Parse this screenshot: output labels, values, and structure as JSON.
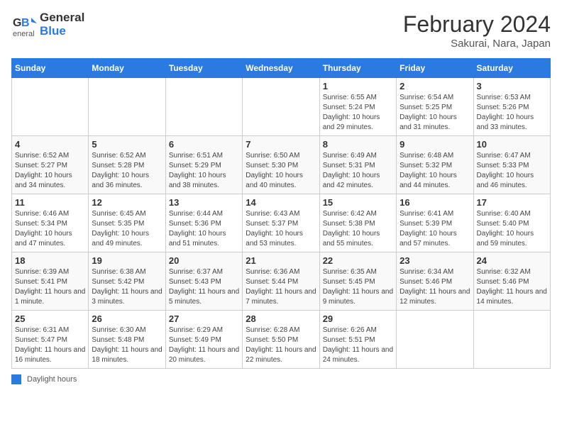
{
  "header": {
    "logo_line1": "General",
    "logo_line2": "Blue",
    "month": "February 2024",
    "location": "Sakurai, Nara, Japan"
  },
  "weekdays": [
    "Sunday",
    "Monday",
    "Tuesday",
    "Wednesday",
    "Thursday",
    "Friday",
    "Saturday"
  ],
  "weeks": [
    [
      {
        "day": "",
        "sunrise": "",
        "sunset": "",
        "daylight": ""
      },
      {
        "day": "",
        "sunrise": "",
        "sunset": "",
        "daylight": ""
      },
      {
        "day": "",
        "sunrise": "",
        "sunset": "",
        "daylight": ""
      },
      {
        "day": "",
        "sunrise": "",
        "sunset": "",
        "daylight": ""
      },
      {
        "day": "1",
        "sunrise": "Sunrise: 6:55 AM",
        "sunset": "Sunset: 5:24 PM",
        "daylight": "Daylight: 10 hours and 29 minutes."
      },
      {
        "day": "2",
        "sunrise": "Sunrise: 6:54 AM",
        "sunset": "Sunset: 5:25 PM",
        "daylight": "Daylight: 10 hours and 31 minutes."
      },
      {
        "day": "3",
        "sunrise": "Sunrise: 6:53 AM",
        "sunset": "Sunset: 5:26 PM",
        "daylight": "Daylight: 10 hours and 33 minutes."
      }
    ],
    [
      {
        "day": "4",
        "sunrise": "Sunrise: 6:52 AM",
        "sunset": "Sunset: 5:27 PM",
        "daylight": "Daylight: 10 hours and 34 minutes."
      },
      {
        "day": "5",
        "sunrise": "Sunrise: 6:52 AM",
        "sunset": "Sunset: 5:28 PM",
        "daylight": "Daylight: 10 hours and 36 minutes."
      },
      {
        "day": "6",
        "sunrise": "Sunrise: 6:51 AM",
        "sunset": "Sunset: 5:29 PM",
        "daylight": "Daylight: 10 hours and 38 minutes."
      },
      {
        "day": "7",
        "sunrise": "Sunrise: 6:50 AM",
        "sunset": "Sunset: 5:30 PM",
        "daylight": "Daylight: 10 hours and 40 minutes."
      },
      {
        "day": "8",
        "sunrise": "Sunrise: 6:49 AM",
        "sunset": "Sunset: 5:31 PM",
        "daylight": "Daylight: 10 hours and 42 minutes."
      },
      {
        "day": "9",
        "sunrise": "Sunrise: 6:48 AM",
        "sunset": "Sunset: 5:32 PM",
        "daylight": "Daylight: 10 hours and 44 minutes."
      },
      {
        "day": "10",
        "sunrise": "Sunrise: 6:47 AM",
        "sunset": "Sunset: 5:33 PM",
        "daylight": "Daylight: 10 hours and 46 minutes."
      }
    ],
    [
      {
        "day": "11",
        "sunrise": "Sunrise: 6:46 AM",
        "sunset": "Sunset: 5:34 PM",
        "daylight": "Daylight: 10 hours and 47 minutes."
      },
      {
        "day": "12",
        "sunrise": "Sunrise: 6:45 AM",
        "sunset": "Sunset: 5:35 PM",
        "daylight": "Daylight: 10 hours and 49 minutes."
      },
      {
        "day": "13",
        "sunrise": "Sunrise: 6:44 AM",
        "sunset": "Sunset: 5:36 PM",
        "daylight": "Daylight: 10 hours and 51 minutes."
      },
      {
        "day": "14",
        "sunrise": "Sunrise: 6:43 AM",
        "sunset": "Sunset: 5:37 PM",
        "daylight": "Daylight: 10 hours and 53 minutes."
      },
      {
        "day": "15",
        "sunrise": "Sunrise: 6:42 AM",
        "sunset": "Sunset: 5:38 PM",
        "daylight": "Daylight: 10 hours and 55 minutes."
      },
      {
        "day": "16",
        "sunrise": "Sunrise: 6:41 AM",
        "sunset": "Sunset: 5:39 PM",
        "daylight": "Daylight: 10 hours and 57 minutes."
      },
      {
        "day": "17",
        "sunrise": "Sunrise: 6:40 AM",
        "sunset": "Sunset: 5:40 PM",
        "daylight": "Daylight: 10 hours and 59 minutes."
      }
    ],
    [
      {
        "day": "18",
        "sunrise": "Sunrise: 6:39 AM",
        "sunset": "Sunset: 5:41 PM",
        "daylight": "Daylight: 11 hours and 1 minute."
      },
      {
        "day": "19",
        "sunrise": "Sunrise: 6:38 AM",
        "sunset": "Sunset: 5:42 PM",
        "daylight": "Daylight: 11 hours and 3 minutes."
      },
      {
        "day": "20",
        "sunrise": "Sunrise: 6:37 AM",
        "sunset": "Sunset: 5:43 PM",
        "daylight": "Daylight: 11 hours and 5 minutes."
      },
      {
        "day": "21",
        "sunrise": "Sunrise: 6:36 AM",
        "sunset": "Sunset: 5:44 PM",
        "daylight": "Daylight: 11 hours and 7 minutes."
      },
      {
        "day": "22",
        "sunrise": "Sunrise: 6:35 AM",
        "sunset": "Sunset: 5:45 PM",
        "daylight": "Daylight: 11 hours and 9 minutes."
      },
      {
        "day": "23",
        "sunrise": "Sunrise: 6:34 AM",
        "sunset": "Sunset: 5:46 PM",
        "daylight": "Daylight: 11 hours and 12 minutes."
      },
      {
        "day": "24",
        "sunrise": "Sunrise: 6:32 AM",
        "sunset": "Sunset: 5:46 PM",
        "daylight": "Daylight: 11 hours and 14 minutes."
      }
    ],
    [
      {
        "day": "25",
        "sunrise": "Sunrise: 6:31 AM",
        "sunset": "Sunset: 5:47 PM",
        "daylight": "Daylight: 11 hours and 16 minutes."
      },
      {
        "day": "26",
        "sunrise": "Sunrise: 6:30 AM",
        "sunset": "Sunset: 5:48 PM",
        "daylight": "Daylight: 11 hours and 18 minutes."
      },
      {
        "day": "27",
        "sunrise": "Sunrise: 6:29 AM",
        "sunset": "Sunset: 5:49 PM",
        "daylight": "Daylight: 11 hours and 20 minutes."
      },
      {
        "day": "28",
        "sunrise": "Sunrise: 6:28 AM",
        "sunset": "Sunset: 5:50 PM",
        "daylight": "Daylight: 11 hours and 22 minutes."
      },
      {
        "day": "29",
        "sunrise": "Sunrise: 6:26 AM",
        "sunset": "Sunset: 5:51 PM",
        "daylight": "Daylight: 11 hours and 24 minutes."
      },
      {
        "day": "",
        "sunrise": "",
        "sunset": "",
        "daylight": ""
      },
      {
        "day": "",
        "sunrise": "",
        "sunset": "",
        "daylight": ""
      }
    ]
  ],
  "legend": {
    "label": "Daylight hours"
  }
}
